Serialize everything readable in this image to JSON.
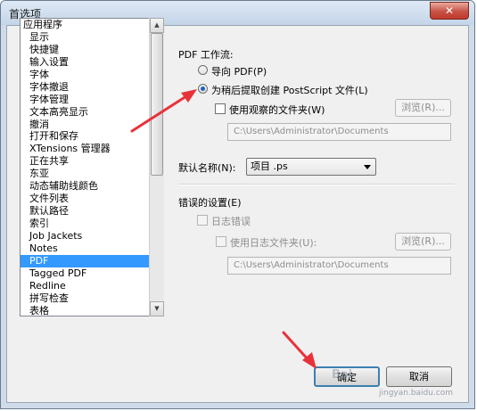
{
  "window": {
    "title": "首选项",
    "close_label": "✕"
  },
  "sidebar": {
    "items": [
      {
        "label": "应用程序",
        "indent": false,
        "selected": false
      },
      {
        "label": "显示",
        "indent": true,
        "selected": false
      },
      {
        "label": "快捷键",
        "indent": true,
        "selected": false
      },
      {
        "label": "输入设置",
        "indent": true,
        "selected": false
      },
      {
        "label": "字体",
        "indent": true,
        "selected": false
      },
      {
        "label": "字体撤退",
        "indent": true,
        "selected": false
      },
      {
        "label": "字体管理",
        "indent": true,
        "selected": false
      },
      {
        "label": "文本高亮显示",
        "indent": true,
        "selected": false
      },
      {
        "label": "撤消",
        "indent": true,
        "selected": false
      },
      {
        "label": "打开和保存",
        "indent": true,
        "selected": false
      },
      {
        "label": "XTensions 管理器",
        "indent": true,
        "selected": false
      },
      {
        "label": "正在共享",
        "indent": true,
        "selected": false
      },
      {
        "label": "东亚",
        "indent": true,
        "selected": false
      },
      {
        "label": "动态辅助线颜色",
        "indent": true,
        "selected": false
      },
      {
        "label": "文件列表",
        "indent": true,
        "selected": false
      },
      {
        "label": "默认路径",
        "indent": true,
        "selected": false
      },
      {
        "label": "索引",
        "indent": true,
        "selected": false
      },
      {
        "label": "Job Jackets",
        "indent": true,
        "selected": false
      },
      {
        "label": "Notes",
        "indent": true,
        "selected": false
      },
      {
        "label": "PDF",
        "indent": true,
        "selected": true
      },
      {
        "label": "Tagged PDF",
        "indent": true,
        "selected": false
      },
      {
        "label": "Redline",
        "indent": true,
        "selected": false
      },
      {
        "label": "拼写检查",
        "indent": true,
        "selected": false
      },
      {
        "label": "表格",
        "indent": true,
        "selected": false
      }
    ]
  },
  "pdf_workflow": {
    "group_label": "PDF 工作流:",
    "radio_direct": "导向 PDF(P)",
    "radio_postscript": "为稍后提取创建 PostScript 文件(L)",
    "watch_folder_label": "使用观察的文件夹(W)",
    "browse_label": "浏览(R)...",
    "path_value": "C:\\Users\\Administrator\\Documents"
  },
  "default_name": {
    "label": "默认名称(N):",
    "value": "项目 .ps"
  },
  "errors": {
    "group_label": "错误的设置(E)",
    "log_errors_label": "日志错误",
    "log_folder_label": "使用日志文件夹(U):",
    "browse_label": "浏览(R)...",
    "path_value": "C:\\Users\\Administrator\\Documents"
  },
  "footer": {
    "ok_label": "确定",
    "cancel_label": "取消"
  },
  "watermark": {
    "brand": "Bai",
    "url": "jingyan.baidu.com"
  },
  "colors": {
    "selection": "#3399ff",
    "annotation_arrow": "#e8323a"
  }
}
